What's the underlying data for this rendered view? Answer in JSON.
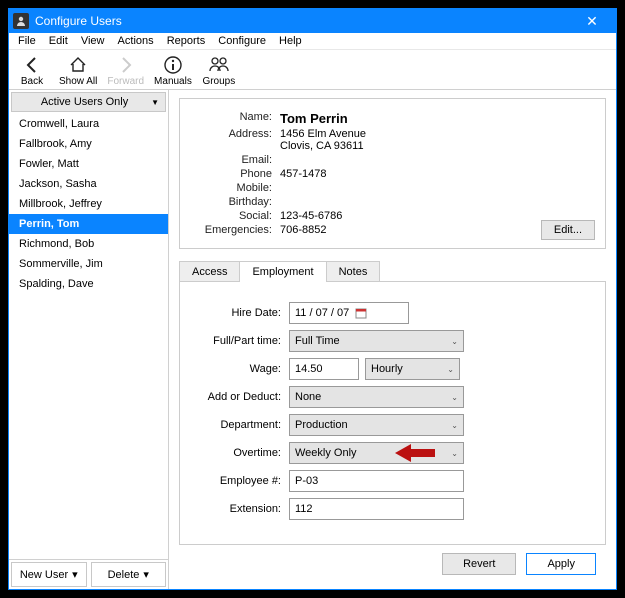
{
  "window": {
    "title": "Configure Users"
  },
  "menu": {
    "items": [
      "File",
      "Edit",
      "View",
      "Actions",
      "Reports",
      "Configure",
      "Help"
    ]
  },
  "toolbar": {
    "back": "Back",
    "showall": "Show All",
    "forward": "Forward",
    "manuals": "Manuals",
    "groups": "Groups"
  },
  "sidebar": {
    "filter": "Active Users Only",
    "users": [
      "Cromwell, Laura",
      "Fallbrook, Amy",
      "Fowler, Matt",
      "Jackson, Sasha",
      "Millbrook, Jeffrey",
      "Perrin, Tom",
      "Richmond, Bob",
      "Sommerville, Jim",
      "Spalding, Dave"
    ],
    "selected_index": 5,
    "new_user": "New User",
    "delete": "Delete"
  },
  "info": {
    "labels": {
      "name": "Name:",
      "address": "Address:",
      "email": "Email:",
      "phone": "Phone",
      "mobile": "Mobile:",
      "birthday": "Birthday:",
      "social": "Social:",
      "emerg": "Emergencies:"
    },
    "name": "Tom Perrin",
    "address1": "1456 Elm Avenue",
    "address2": "Clovis, CA 93611",
    "email": "",
    "phone": "457-1478",
    "mobile": "",
    "birthday": "",
    "social": "123-45-6786",
    "emerg": "706-8852",
    "edit": "Edit..."
  },
  "tabs": {
    "items": [
      "Access",
      "Employment",
      "Notes"
    ],
    "active_index": 1
  },
  "form": {
    "labels": {
      "hire": "Hire Date:",
      "fullpart": "Full/Part time:",
      "wage": "Wage:",
      "addded": "Add or Deduct:",
      "dept": "Department:",
      "ot": "Overtime:",
      "emp": "Employee #:",
      "ext": "Extension:"
    },
    "hire_date": "11 / 07 / 07",
    "fullpart": "Full Time",
    "wage": "14.50",
    "wage_type": "Hourly",
    "addded": "None",
    "dept": "Production",
    "overtime": "Weekly Only",
    "empno": "P-03",
    "ext": "112"
  },
  "footer": {
    "revert": "Revert",
    "apply": "Apply"
  }
}
